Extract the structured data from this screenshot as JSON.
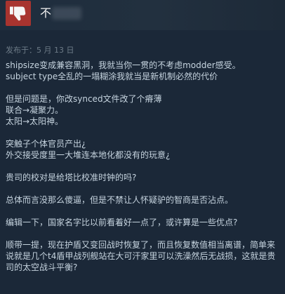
{
  "review": {
    "recommendation": "不",
    "thumb_icon": "thumbs-down-icon",
    "posted_date": "发布于：5 月 13 日",
    "paragraphs": [
      "shipsize变成兼容黑洞，我就当你一贯的不考虑modder感受。\nsubject type全乱的一塌糊涂我就当是新机制必然的代价",
      "但是问题是，你改synced文件改了个瘠薄\n联合→凝聚力。\n太阳→太阳神。",
      "突触子个体官员产出¿\n外交接受度里一大堆连本地化都没有的玩意¿",
      "贵司的校对是给塔比校准时钟的吗?",
      "总体而言没那么傻逼，但是不禁让人怀疑驴的智商是否沾点。",
      "编辑一下，国家名字比以前看着好一点了，或许算是一些优点?",
      "顺带一提，现在护盾又变回战时恢复了，而且恢复数值相当离谱，简单来说就是几个t4盾甲战列舰站在大可汗家里可以洗澡然后无战损，这就是贵司的太空战斗平衡?"
    ]
  },
  "colors": {
    "page_background": "#1b2838",
    "badge_background": "#a8342f",
    "body_text": "#c6d4df",
    "date_text": "#6d7b87"
  }
}
